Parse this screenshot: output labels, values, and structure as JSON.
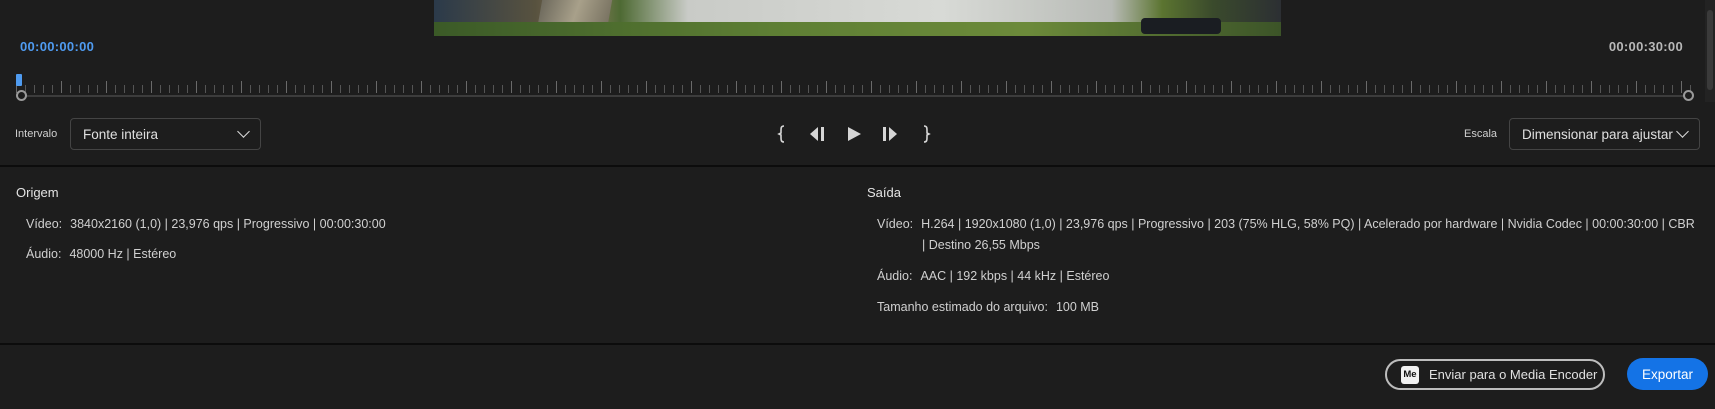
{
  "timeline": {
    "start_time": "00:00:00:00",
    "end_time": "00:00:30:00"
  },
  "controls": {
    "range_label": "Intervalo",
    "range_value": "Fonte inteira",
    "scale_label": "Escala",
    "scale_value": "Dimensionar para ajustar",
    "transport": [
      "mark-in-icon",
      "step-back-icon",
      "play-icon",
      "step-forward-icon",
      "mark-out-icon"
    ]
  },
  "source": {
    "title": "Origem",
    "video_key": "Vídeo:",
    "video_value": "3840x2160 (1,0) | 23,976 qps | Progressivo | 00:00:30:00",
    "audio_key": "Áudio:",
    "audio_value": "48000 Hz | Estéreo"
  },
  "output": {
    "title": "Saída",
    "video_key": "Vídeo:",
    "video_value_line1": "H.264 | 1920x1080 (1,0) | 23,976 qps | Progressivo | 203 (75% HLG, 58% PQ) |  Acelerado por hardware | Nvidia Codec | 00:00:30:00  | CBR",
    "video_value_line2": "| Destino 26,55 Mbps",
    "audio_key": "Áudio:",
    "audio_value": "AAC | 192 kbps | 44 kHz | Estéreo",
    "size_key": "Tamanho estimado do arquivo:",
    "size_value": "100 MB"
  },
  "footer": {
    "media_encoder_icon": "Me",
    "media_encoder_label": "Enviar para o Media Encoder",
    "export_label": "Exportar"
  },
  "colors": {
    "accent": "#1473e6",
    "timecode_active": "#4f9bf0",
    "background": "#1d1d1d"
  }
}
